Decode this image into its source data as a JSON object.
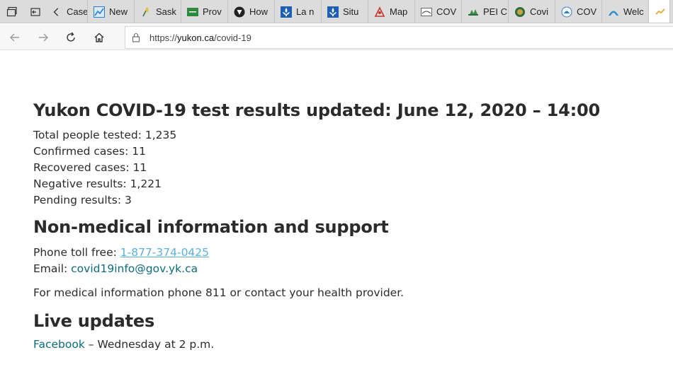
{
  "browser": {
    "tabs": [
      {
        "label": "Case",
        "icon": "document-icon",
        "color": "#6b6b6b"
      },
      {
        "label": "New",
        "icon": "chart-line-icon",
        "color": "#2a7fd4"
      },
      {
        "label": "Sask",
        "icon": "wheat-icon",
        "color": "#e2c12f"
      },
      {
        "label": "Prov",
        "icon": "green-flag-icon",
        "color": "#2e8b3e"
      },
      {
        "label": "How",
        "icon": "shield-icon",
        "color": "#222222"
      },
      {
        "label": "La n",
        "icon": "fleur-de-lis-icon",
        "color": "#1d5fb4"
      },
      {
        "label": "Situ",
        "icon": "fleur-de-lis-icon",
        "color": "#1d5fb4"
      },
      {
        "label": "Map",
        "icon": "map-pin-icon",
        "color": "#c0392b"
      },
      {
        "label": "COV",
        "icon": "bridge-icon",
        "color": "#666666"
      },
      {
        "label": "PEI C",
        "icon": "trees-icon",
        "color": "#3b8f4a"
      },
      {
        "label": "Covi",
        "icon": "globe-icon",
        "color": "#2a6e3f"
      },
      {
        "label": "COV",
        "icon": "crest-icon",
        "color": "#2a7fd4"
      },
      {
        "label": "Welc",
        "icon": "arch-icon",
        "color": "#2a8fcf"
      }
    ],
    "url_host": "yukon.ca",
    "url_prefix": "https://",
    "url_path": "/covid-19"
  },
  "page": {
    "title": "Yukon COVID-19 test results updated: June 12, 2020 – 14:00",
    "stats": [
      "Total people tested: 1,235",
      "Confirmed cases: 11",
      "Recovered cases: 11",
      "Negative results: 1,221",
      "Pending results: 3"
    ],
    "support_heading": "Non-medical information and support",
    "phone_label": "Phone toll free: ",
    "phone_number": "1-877-374-0425",
    "email_label": "Email: ",
    "email_address": "covid19info@gov.yk.ca",
    "medical_text": "For medical information phone 811 or contact your health provider.",
    "live_heading": "Live updates",
    "facebook_link": "Facebook",
    "facebook_text": " – Wednesday at 2 p.m."
  }
}
